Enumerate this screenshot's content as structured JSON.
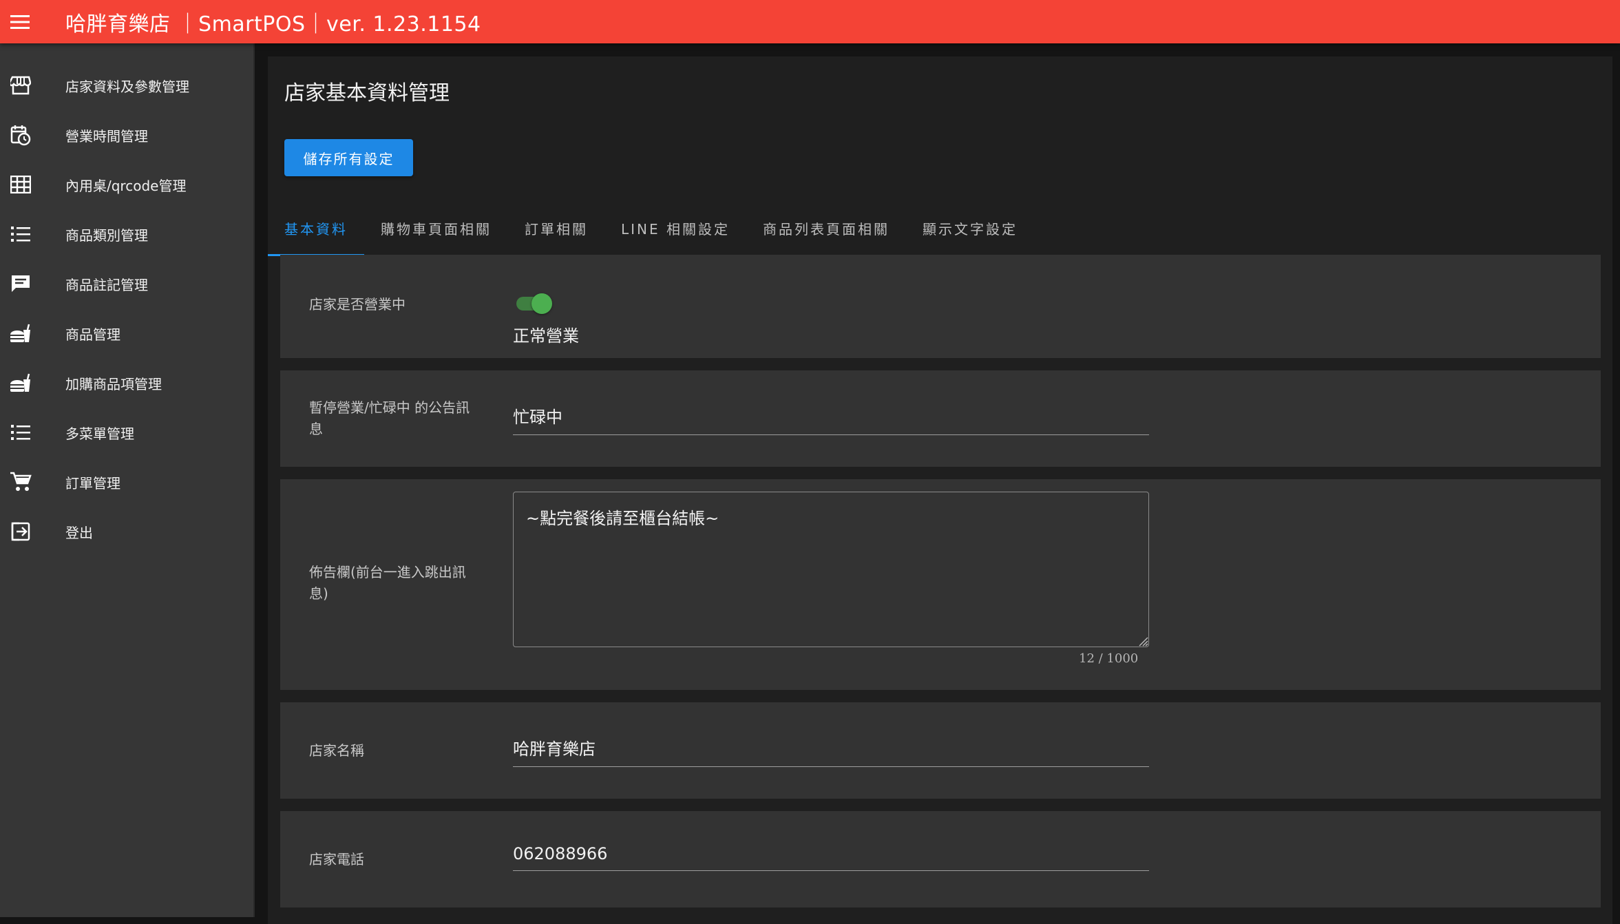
{
  "header": {
    "title": "哈胖育樂店 ｜SmartPOS｜ver. 1.23.1154",
    "menu_icon": "hamburger-menu-icon",
    "color": "#f44336"
  },
  "sidebar": {
    "items": [
      {
        "label": "店家資料及參數管理",
        "icon": "storefront-icon"
      },
      {
        "label": "營業時間管理",
        "icon": "calendar-clock-icon"
      },
      {
        "label": "內用桌/qrcode管理",
        "icon": "table-grid-icon"
      },
      {
        "label": "商品類別管理",
        "icon": "list-icon"
      },
      {
        "label": "商品註記管理",
        "icon": "comment-text-icon"
      },
      {
        "label": "商品管理",
        "icon": "food-drink-icon"
      },
      {
        "label": "加購商品項管理",
        "icon": "food-drink-icon"
      },
      {
        "label": "多菜單管理",
        "icon": "list-icon"
      },
      {
        "label": "訂單管理",
        "icon": "cart-icon"
      },
      {
        "label": "登出",
        "icon": "logout-icon"
      }
    ]
  },
  "main": {
    "title": "店家基本資料管理",
    "save_label": "儲存所有設定",
    "tabs": [
      {
        "label": "基本資料",
        "active": true
      },
      {
        "label": "購物車頁面相關",
        "active": false
      },
      {
        "label": "訂單相關",
        "active": false
      },
      {
        "label": "LINE 相關設定",
        "active": false
      },
      {
        "label": "商品列表頁面相關",
        "active": false
      },
      {
        "label": "顯示文字設定",
        "active": false
      }
    ],
    "accent_color": "#2196f3",
    "fields": {
      "open_status": {
        "label": "店家是否營業中",
        "toggle_on": true,
        "value_text": "正常營業"
      },
      "pause_message": {
        "label": "暫停營業/忙碌中 的公告訊息",
        "value": "忙碌中"
      },
      "bulletin": {
        "label": "佈告欄(前台一進入跳出訊息)",
        "value": "~點完餐後請至櫃台結帳~",
        "counter": "12 / 1000"
      },
      "store_name": {
        "label": "店家名稱",
        "value": "哈胖育樂店"
      },
      "store_phone": {
        "label": "店家電話",
        "value": "062088966"
      }
    }
  }
}
